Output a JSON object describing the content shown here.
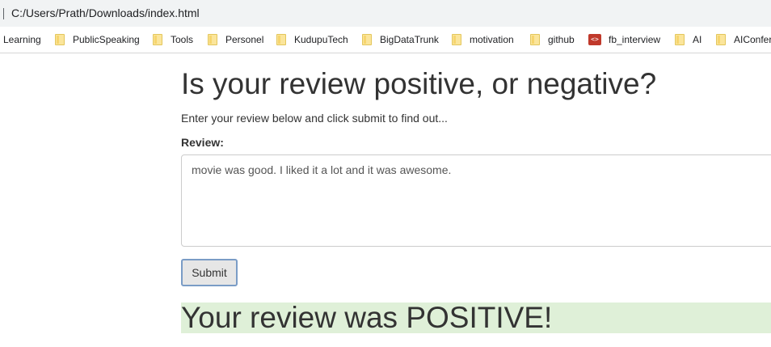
{
  "browser": {
    "address": "C:/Users/Prath/Downloads/index.html",
    "bookmarks": [
      {
        "label": "Learning",
        "icon": "none"
      },
      {
        "label": "PublicSpeaking",
        "icon": "folder-icon"
      },
      {
        "label": "Tools",
        "icon": "folder-icon"
      },
      {
        "label": "Personel",
        "icon": "folder-icon"
      },
      {
        "label": "KudupuTech",
        "icon": "folder-icon"
      },
      {
        "label": "BigDataTrunk",
        "icon": "folder-icon"
      },
      {
        "label": "motivation",
        "icon": "folder-icon"
      },
      {
        "label": "github",
        "icon": "folder-icon"
      },
      {
        "label": "fb_interview",
        "icon": "code-icon"
      },
      {
        "label": "AI",
        "icon": "folder-icon"
      },
      {
        "label": "AIConfer",
        "icon": "folder-icon"
      }
    ]
  },
  "page": {
    "title": "Is your review positive, or negative?",
    "subtitle": "Enter your review below and click submit to find out...",
    "review_label": "Review:",
    "review_value": "movie was good. I liked it a lot and it was awesome.",
    "submit_label": "Submit",
    "result_text": "Your review was POSITIVE!",
    "result_color": "#dff0d8"
  }
}
